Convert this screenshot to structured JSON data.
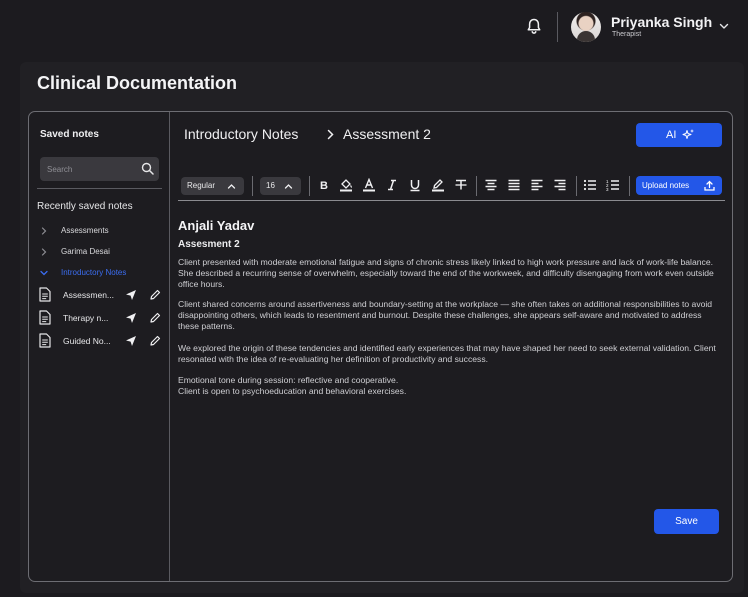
{
  "header": {
    "user_name": "Priyanka Singh",
    "user_role": "Therapist",
    "icons": [
      "bell-icon",
      "avatar",
      "chevron-down-icon"
    ]
  },
  "page": {
    "title": "Clinical Documentation"
  },
  "sidebar": {
    "title": "Saved notes",
    "search_placeholder": "Search",
    "recent_title": "Recently saved notes",
    "folders": [
      {
        "label": "Assessments",
        "expanded": false
      },
      {
        "label": "Garima Desai",
        "expanded": false
      },
      {
        "label": "Introductory Notes",
        "expanded": true
      }
    ],
    "notes": [
      {
        "label": "Assessmen..."
      },
      {
        "label": "Therapy n..."
      },
      {
        "label": "Guided No..."
      }
    ]
  },
  "editor": {
    "breadcrumb": [
      "Introductory Notes",
      "Assessment 2"
    ],
    "ai_label": "AI",
    "font_style": "Regular",
    "font_size": "16",
    "upload_label": "Upload notes",
    "client_name": "Anjali Yadav",
    "note_title": "Assesment 2",
    "paragraphs": [
      "Client presented with moderate emotional fatigue and signs of chronic stress likely linked to high work pressure and lack of work-life balance. She described a recurring sense of overwhelm, especially toward the end of the workweek, and difficulty disengaging from work even outside office hours.",
      "Client shared concerns around assertiveness and boundary-setting at the workplace — she often takes on additional responsibilities to avoid disappointing others, which leads to resentment and burnout. Despite these challenges, she appears self-aware and motivated to address these patterns.",
      "We explored the origin of these tendencies and identified early experiences that may have shaped her need to seek external validation. Client resonated with the idea of re-evaluating her definition of productivity and success.",
      "Emotional tone during session: reflective and cooperative.",
      "Client is open to psychoeducation and behavioral exercises."
    ],
    "save_label": "Save"
  },
  "colors": {
    "accent": "#2357e8",
    "active_link": "#3b6df0",
    "background": "#1c1b1f",
    "panel": "#212024"
  }
}
